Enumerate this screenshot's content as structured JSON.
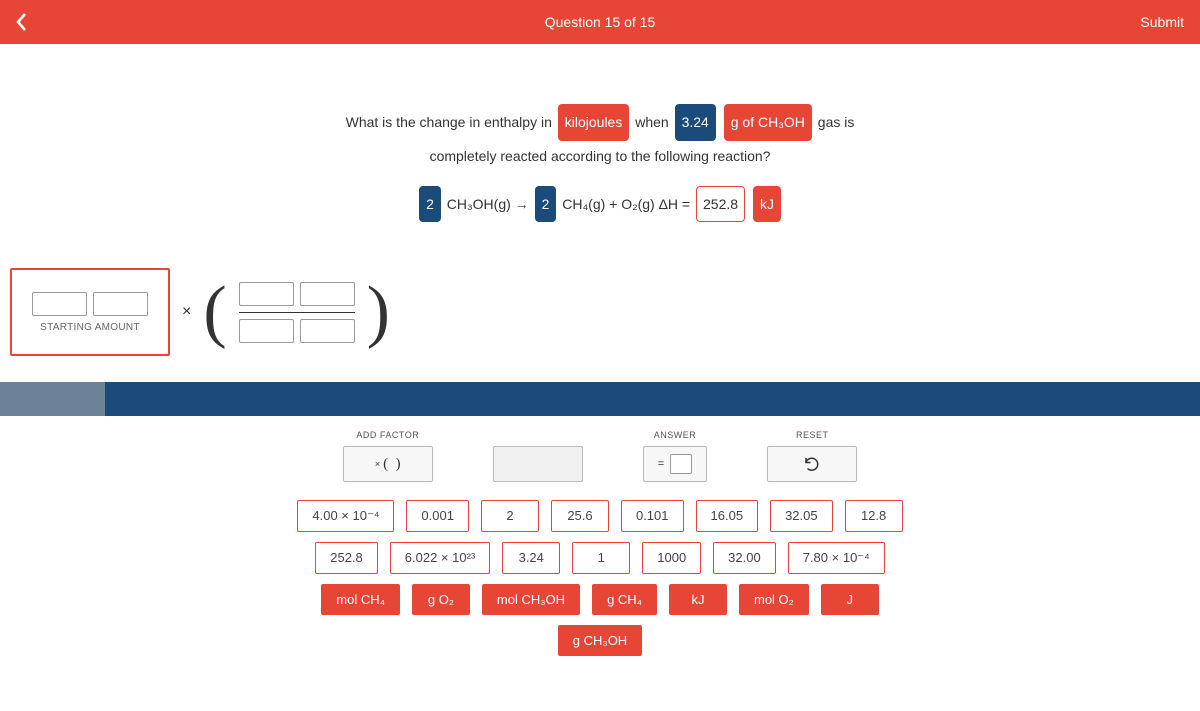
{
  "header": {
    "title": "Question 15 of 15",
    "submit": "Submit"
  },
  "prompt": {
    "t1": "What is the change in enthalpy in",
    "chip_kj": "kilojoules",
    "t2": "when",
    "chip_mass": "3.24",
    "chip_sub": "g of CH₃OH",
    "t3": "gas is",
    "t4": "completely reacted according to the following reaction?",
    "eq_coef1": "2",
    "eq_r1": "CH₃OH(g) →",
    "eq_coef2": "2",
    "eq_r2": "CH₄(g) + O₂(g) ΔH =",
    "eq_dh": "252.8",
    "eq_unit": "kJ"
  },
  "work": {
    "starting_label": "STARTING AMOUNT",
    "mult": "×"
  },
  "controls": {
    "add_factor": "ADD FACTOR",
    "answer": "ANSWER",
    "reset": "RESET",
    "eq": "="
  },
  "tiles": {
    "row1": [
      "4.00 × 10⁻⁴",
      "0.001",
      "2",
      "25.6",
      "0.101",
      "16.05",
      "32.05",
      "12.8"
    ],
    "row2": [
      "252.8",
      "6.022 × 10²³",
      "3.24",
      "1",
      "1000",
      "32.00",
      "7.80 × 10⁻⁴"
    ],
    "row3": [
      "mol CH₄",
      "g O₂",
      "mol CH₃OH",
      "g CH₄",
      "kJ",
      "mol O₂",
      "J"
    ],
    "row4": [
      "g CH₃OH"
    ]
  }
}
